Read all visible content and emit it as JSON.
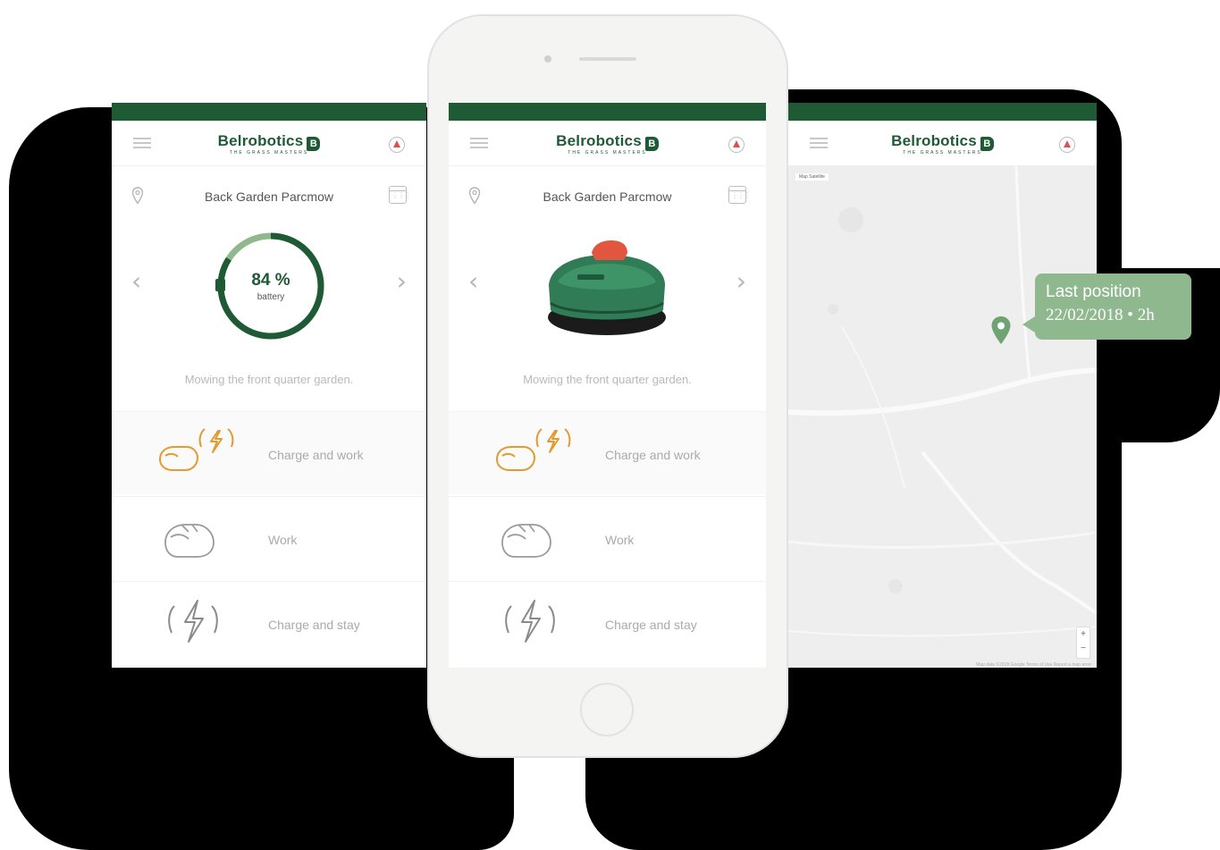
{
  "colors": {
    "brand_green": "#1e5a34",
    "tooltip_green": "#8fb88e",
    "charge_orange": "#e39a2f",
    "muted_gray": "#b9b9b9"
  },
  "app": {
    "logo_text": "Belrobotics",
    "logo_badge": "B",
    "logo_tagline": "THE GRASS MASTERS"
  },
  "screens": {
    "left": {
      "garden_name": "Back Garden Parcmow",
      "battery_value": "84 %",
      "battery_label": "battery",
      "battery_level": 0.84,
      "status": "Mowing the front quarter garden."
    },
    "middle": {
      "garden_name": "Back Garden Parcmow",
      "status": "Mowing the front quarter garden.",
      "mower_image": "robotic-lawn-mower"
    },
    "right": {
      "map_badge": "Map  Satellite",
      "map_zoom_in": "+",
      "map_zoom_out": "−",
      "map_credits": "Map data ©2018 Google  Terms of Use  Report a map error"
    }
  },
  "modes": [
    {
      "label": "Charge and work",
      "icon": "mower-charge-icon",
      "active": true
    },
    {
      "label": "Work",
      "icon": "mower-icon",
      "active": false
    },
    {
      "label": "Charge and stay",
      "icon": "lightning-icon",
      "active": false
    }
  ],
  "tooltip": {
    "title": "Last position",
    "date": "22/02/2018 • 2h"
  }
}
